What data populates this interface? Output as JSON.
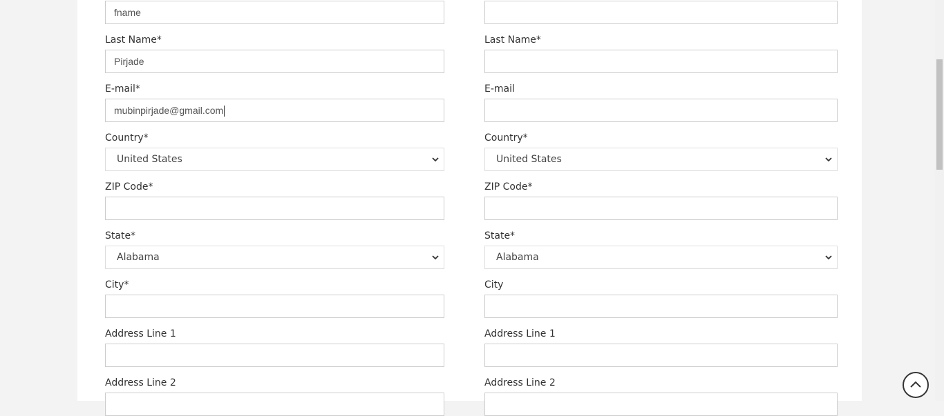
{
  "billing": {
    "first_name_value": "fname",
    "last_name_label": "Last Name*",
    "last_name_value": "Pirjade",
    "email_label": "E-mail*",
    "email_value": "mubinpirjade@gmail.com",
    "country_label": "Country*",
    "country_value": "United States",
    "zip_label": "ZIP Code*",
    "zip_value": "",
    "state_label": "State*",
    "state_value": "Alabama",
    "city_label": "City*",
    "city_value": "",
    "address1_label": "Address Line 1",
    "address1_value": "",
    "address2_label": "Address Line 2"
  },
  "shipping": {
    "first_name_value": "",
    "last_name_label": "Last Name*",
    "last_name_value": "",
    "email_label": "E-mail",
    "email_value": "",
    "country_label": "Country*",
    "country_value": "United States",
    "zip_label": "ZIP Code*",
    "zip_value": "",
    "state_label": "State*",
    "state_value": "Alabama",
    "city_label": "City",
    "city_value": "",
    "address1_label": "Address Line 1",
    "address1_value": "",
    "address2_label": "Address Line 2"
  },
  "icons": {
    "select_arrow": "chevron-down-icon",
    "scroll_top": "chevron-up-circle-icon"
  },
  "colors": {
    "page_bg": "#f3f3f3",
    "form_bg": "#ffffff",
    "border": "#cccccc",
    "label_text": "#333333"
  }
}
